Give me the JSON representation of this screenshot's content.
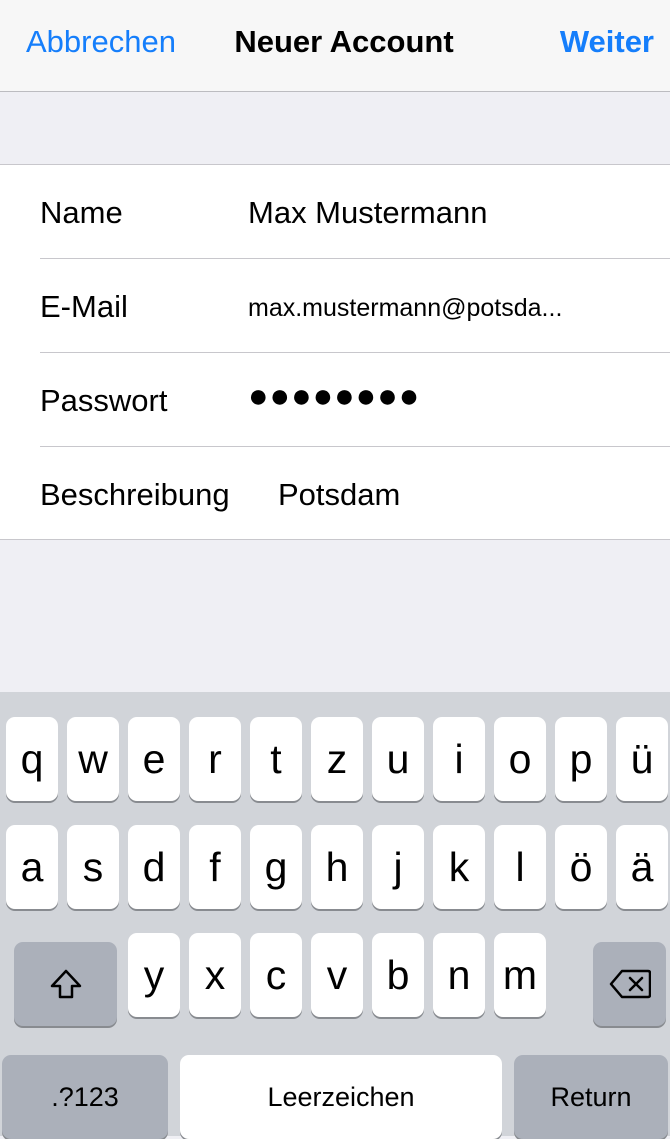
{
  "navbar": {
    "cancel_label": "Abbrechen",
    "title": "Neuer Account",
    "next_label": "Weiter"
  },
  "form": {
    "fields": [
      {
        "label": "Name",
        "value": "Max Mustermann"
      },
      {
        "label": "E-Mail",
        "value": "max.mustermann@potsda..."
      },
      {
        "label": "Passwort",
        "value": "●●●●●●●●"
      },
      {
        "label": "Beschreibung",
        "value": "Potsdam"
      }
    ]
  },
  "keyboard": {
    "row1": [
      "q",
      "w",
      "e",
      "r",
      "t",
      "z",
      "u",
      "i",
      "o",
      "p",
      "ü"
    ],
    "row2": [
      "a",
      "s",
      "d",
      "f",
      "g",
      "h",
      "j",
      "k",
      "l",
      "ö",
      "ä"
    ],
    "row3": [
      "y",
      "x",
      "c",
      "v",
      "b",
      "n",
      "m"
    ],
    "shift_icon": "shift-icon",
    "delete_icon": "backspace-icon",
    "numbers_label": ".?123",
    "space_label": "Leerzeichen",
    "return_label": "Return"
  },
  "colors": {
    "accent": "#157efb",
    "background": "#efeff4",
    "keyboard_bg": "#d1d4d9",
    "dark_key": "#abb0ba"
  }
}
